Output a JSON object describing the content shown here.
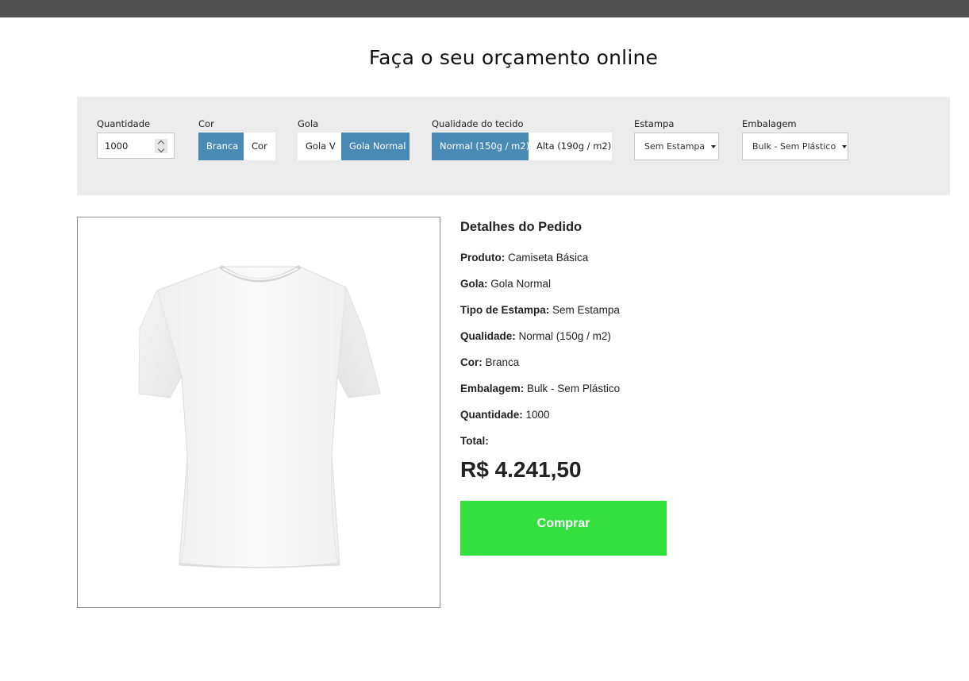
{
  "page_title": "Faça o seu orçamento online",
  "options": {
    "quantity": {
      "label": "Quantidade",
      "value": "1000"
    },
    "color": {
      "label": "Cor",
      "options": [
        "Branca",
        "Cor"
      ],
      "selected": "Branca"
    },
    "collar": {
      "label": "Gola",
      "options": [
        "Gola V",
        "Gola Normal"
      ],
      "selected": "Gola Normal"
    },
    "fabric": {
      "label": "Qualidade do tecido",
      "options": [
        "Normal (150g / m2)",
        "Alta (190g / m2)"
      ],
      "selected": "Normal (150g / m2)"
    },
    "print": {
      "label": "Estampa",
      "selected": "Sem Estampa"
    },
    "packaging": {
      "label": "Embalagem",
      "selected": "Bulk - Sem Plástico"
    }
  },
  "product_image": {
    "icon": "white-t-shirt"
  },
  "details": {
    "title": "Detalhes do Pedido",
    "rows": [
      {
        "key": "Produto:",
        "value": "Camiseta Básica"
      },
      {
        "key": "Gola:",
        "value": "Gola Normal"
      },
      {
        "key": "Tipo de Estampa:",
        "value": "Sem Estampa"
      },
      {
        "key": "Qualidade:",
        "value": "Normal (150g / m2)"
      },
      {
        "key": "Cor:",
        "value": "Branca"
      },
      {
        "key": "Embalagem:",
        "value": "Bulk - Sem Plástico"
      },
      {
        "key": "Quantidade:",
        "value": "1000"
      },
      {
        "key": "Total:",
        "value": ""
      }
    ],
    "total_price": "R$ 4.241,50",
    "buy_label": "Comprar"
  },
  "colors": {
    "accent": "#4a8bb5",
    "buy_button": "#34e03d",
    "top_bar": "#525252",
    "panel_bg": "#ececec"
  }
}
